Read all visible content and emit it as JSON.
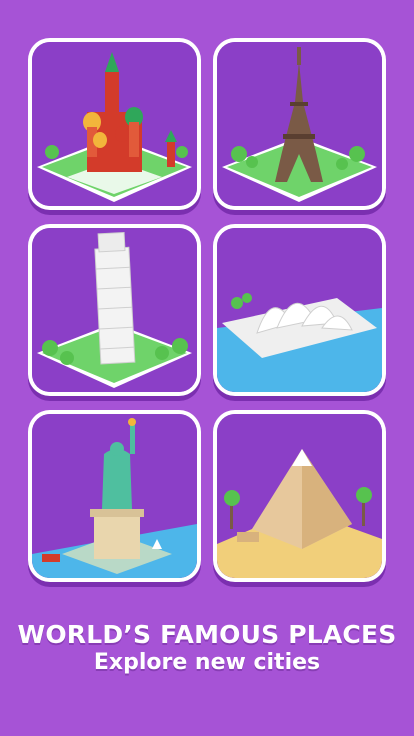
{
  "cards": [
    {
      "landmark": "moscow-cathedral"
    },
    {
      "landmark": "eiffel-tower"
    },
    {
      "landmark": "leaning-tower-pisa"
    },
    {
      "landmark": "sydney-opera-house"
    },
    {
      "landmark": "statue-of-liberty"
    },
    {
      "landmark": "pyramid"
    }
  ],
  "headline": "WORLD’S FAMOUS PLACES",
  "subheadline": "Explore new cities",
  "colors": {
    "background": "#a653d6",
    "card_border": "#ffffff",
    "card_inner": "#8b3fc7",
    "grass": "#6fd36a",
    "water": "#4db6ea",
    "sand": "#f1cf7a"
  }
}
